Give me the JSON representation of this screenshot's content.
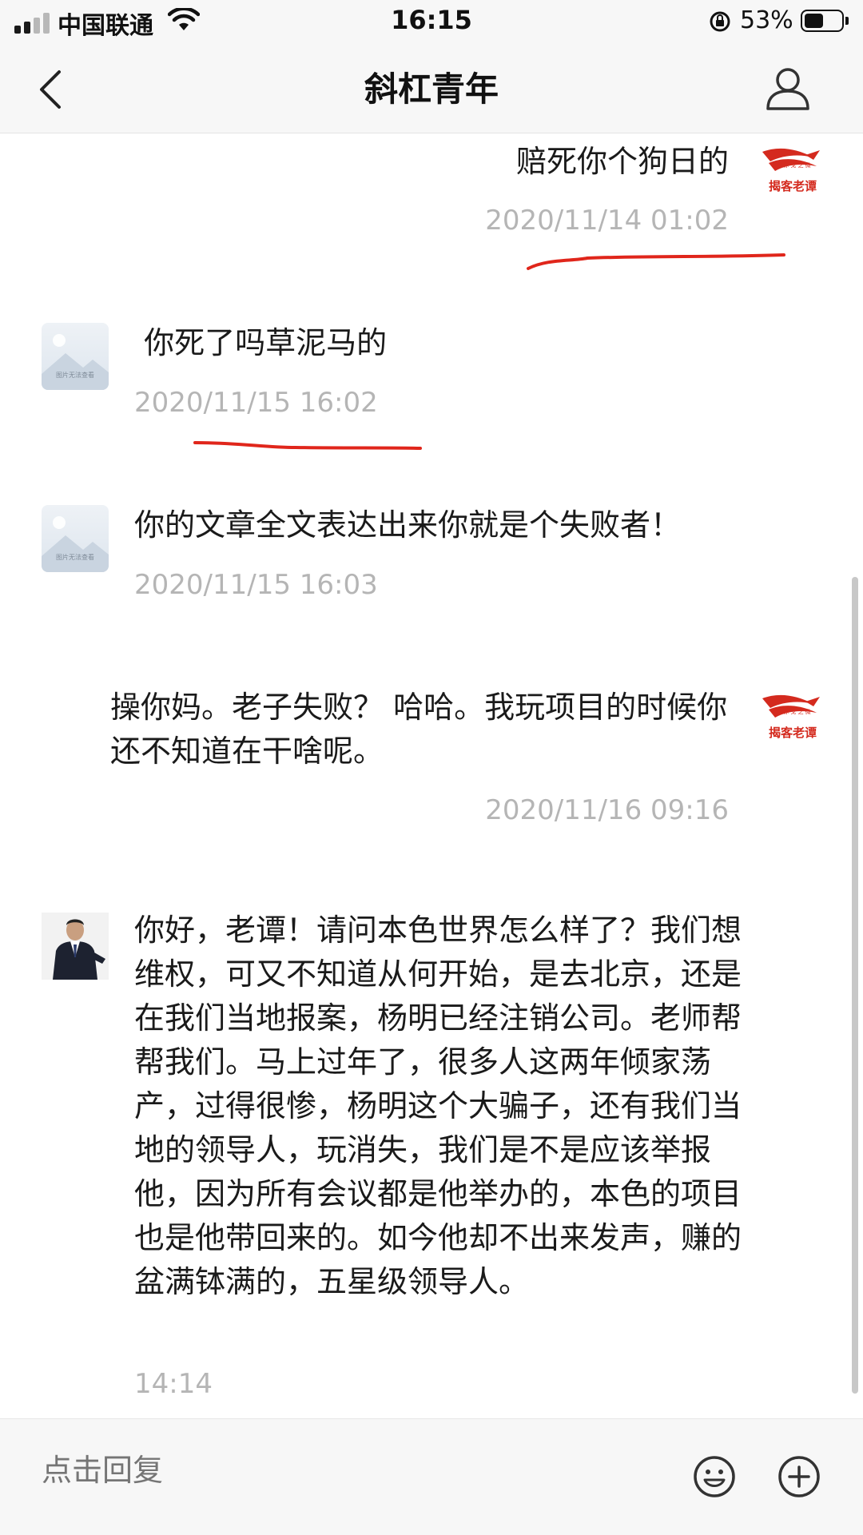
{
  "status_bar": {
    "carrier": "中国联通",
    "time": "16:15",
    "battery_percent": "53%",
    "battery_level": 0.53
  },
  "nav": {
    "title": "斜杠青年"
  },
  "messages": [
    {
      "side": "right",
      "text": "赔死你个狗日的",
      "time": "2020/11/14 01:02"
    },
    {
      "side": "left",
      "text": " 你死了吗草泥马的",
      "time": "2020/11/15 16:02"
    },
    {
      "side": "left",
      "text": "你的文章全文表达出来你就是个失败者！",
      "time": "2020/11/15 16:03"
    },
    {
      "side": "right",
      "text": "操你妈。老子失败？  哈哈。我玩项目的时候你还不知道在干啥呢。",
      "time": "2020/11/16 09:16"
    },
    {
      "side": "left",
      "text": "你好，老谭！请问本色世界怎么样了？我们想维权，可又不知道从何开始，是去北京，还是在我们当地报案，杨明已经注销公司。老师帮帮我们。马上过年了，很多人这两年倾家荡产，过得很惨，杨明这个大骗子，还有我们当地的领导人，玩消失，我们是不是应该举报他，因为所有会议都是他举办的，本色的项目也是他带回来的。如今他却不出来发声，赚的盆满钵满的，五星级领导人。",
      "time": "14:14"
    }
  ],
  "logo": {
    "top_text": "赤  戈  之  微",
    "main_text": "揭客老谭"
  },
  "placeholder_avatar_text": "图片无法查看",
  "reply": {
    "placeholder": "点击回复"
  },
  "colors": {
    "underline": "#e0261b",
    "logo_red": "#d42a1e",
    "timestamp": "#b5b5b5"
  },
  "icons": [
    "back-icon",
    "profile-icon",
    "emoji-icon",
    "plus-icon"
  ]
}
